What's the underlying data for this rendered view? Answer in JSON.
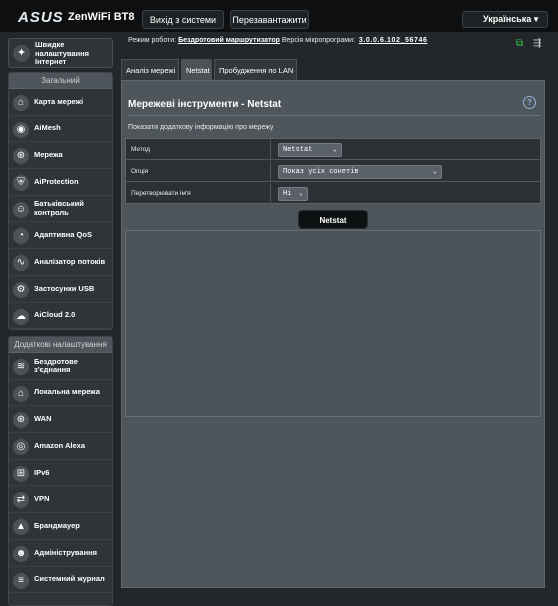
{
  "header": {
    "brand": "ASUS",
    "model": "ZenWiFi BT8",
    "logout_label": "Вихід з системи",
    "reboot_label": "Перезавантажити",
    "language": "Українська"
  },
  "status": {
    "mode_label": "Режим роботи:",
    "mode_value": "Бездротовий маршрутизатор",
    "firmware_label": "Версія мікропрограми:",
    "firmware_value": "3.0.0.6.102_56746",
    "icons": [
      "network-status-icon",
      "usb-status-icon"
    ]
  },
  "sidebar": {
    "quick_setup": "Швидке налаштування Інтернет",
    "general_title": "Загальний",
    "general_items": [
      {
        "label": "Карта мережі",
        "icon": "map-icon"
      },
      {
        "label": "AiMesh",
        "icon": "aimesh-icon"
      },
      {
        "label": "Мережа",
        "icon": "globe-icon"
      },
      {
        "label": "AiProtection",
        "icon": "shield-icon"
      },
      {
        "label": "Батьківський контроль",
        "icon": "family-icon"
      },
      {
        "label": "Адаптивна QoS",
        "icon": "gauge-icon"
      },
      {
        "label": "Аналізатор потоків",
        "icon": "chart-icon"
      },
      {
        "label": "Застосунки USB",
        "icon": "usb-icon"
      },
      {
        "label": "AiCloud 2.0",
        "icon": "cloud-icon"
      }
    ],
    "advanced_title": "Додаткові налаштування",
    "advanced_items": [
      {
        "label": "Бездротове з'єднання",
        "icon": "wifi-icon"
      },
      {
        "label": "Локальна мережа",
        "icon": "home-icon"
      },
      {
        "label": "WAN",
        "icon": "globe-icon"
      },
      {
        "label": "Amazon Alexa",
        "icon": "alexa-icon"
      },
      {
        "label": "IPv6",
        "icon": "ipv6-icon"
      },
      {
        "label": "VPN",
        "icon": "vpn-icon"
      },
      {
        "label": "Брандмауер",
        "icon": "firewall-icon"
      },
      {
        "label": "Адміністрування",
        "icon": "admin-icon"
      },
      {
        "label": "Системний журнал",
        "icon": "log-icon"
      }
    ]
  },
  "tabs": [
    {
      "label": "Аналіз мережі",
      "active": false
    },
    {
      "label": "Netstat",
      "active": true
    },
    {
      "label": "Пробудження по LAN",
      "active": false
    }
  ],
  "panel": {
    "title": "Мережеві інструменти - Netstat",
    "hint": "Показати додаткову інформацію про мережу",
    "fields": [
      {
        "label": "Метод",
        "value": "Netstat"
      },
      {
        "label": "Опція",
        "value": "Показ усіх сокетів"
      },
      {
        "label": "Перетворювати ім'я",
        "value": "Ні"
      }
    ],
    "button_label": "Netstat"
  }
}
